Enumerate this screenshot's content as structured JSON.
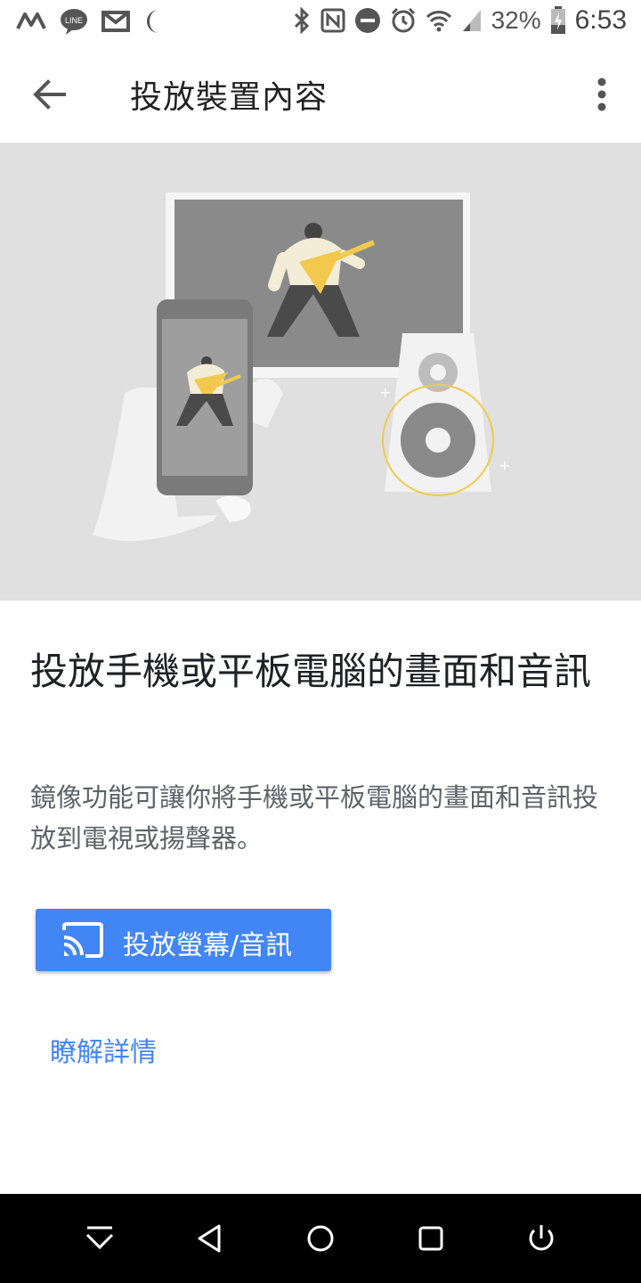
{
  "status_bar": {
    "battery": "32%",
    "time": "6:53",
    "left_icons": [
      "m-app-icon",
      "line-icon",
      "gmail-icon",
      "moon-icon"
    ],
    "right_icons": [
      "bluetooth-icon",
      "nfc-icon",
      "do-not-disturb-icon",
      "alarm-icon",
      "wifi-icon",
      "signal-icon",
      "battery-charging-icon"
    ]
  },
  "app_bar": {
    "title": "投放裝置內容"
  },
  "content": {
    "headline": "投放手機或平板電腦的畫面和音訊",
    "description": "鏡像功能可讓你將手機或平板電腦的畫面和音訊投放到電視或揚聲器。",
    "cast_button_label": "投放螢幕/音訊",
    "learn_more": "瞭解詳情"
  },
  "colors": {
    "accent": "#4285f4",
    "hero_bg": "#e0e0e0",
    "guitar_yellow": "#f2c94c"
  },
  "nav_bar": {
    "items": [
      "collapse-icon",
      "back-icon",
      "home-icon",
      "recents-icon",
      "power-icon"
    ]
  }
}
